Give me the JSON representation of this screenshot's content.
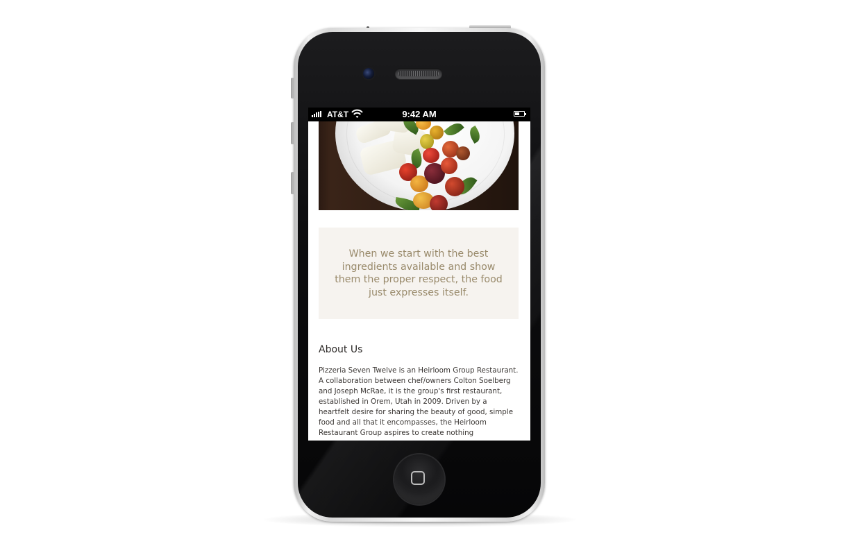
{
  "status_bar": {
    "carrier": "AT&T",
    "time": "9:42 AM"
  },
  "page": {
    "hero_image_alt": "caprese-plate-photo",
    "quote": "When we start with the best ingredients available and show them the proper respect, the food just expresses itself.",
    "about_title": "About Us",
    "about_body": "Pizzeria Seven Twelve is an Heirloom Group Restaurant. A collaboration between chef/owners Colton Soelberg and Joseph McRae, it is the group's first restaurant, established in Orem, Utah in 2009. Driven by a heartfelt desire for sharing the beauty of good, simple food and all that it encompasses, the Heirloom Restaurant Group aspires to create nothing"
  },
  "colors": {
    "quote_bg": "#f6f3ef",
    "quote_text": "#998a6b",
    "body_text": "#3a3633"
  }
}
